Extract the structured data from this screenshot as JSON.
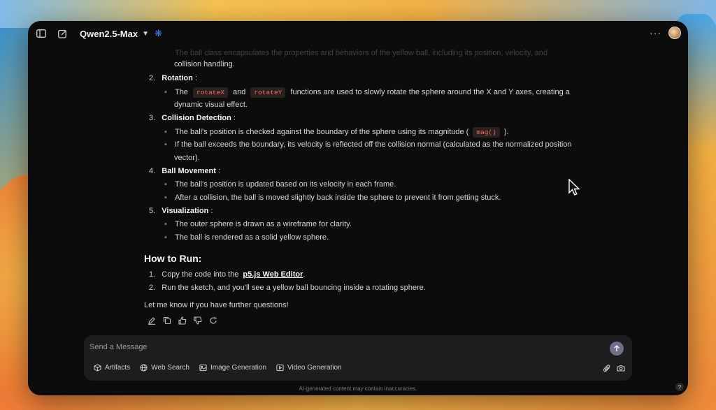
{
  "topbar": {
    "model_name": "Qwen2.5-Max",
    "sidebar_icon": "sidebar-toggle-icon",
    "new_chat_icon": "new-chat-icon"
  },
  "content": {
    "item1_tail_faded": "The  ball  class encapsulates the properties and behaviors of the yellow ball, including its position, velocity, and",
    "item1_tail": "collision handling.",
    "sections": [
      {
        "number": "2.",
        "title": "Rotation",
        "bullets": [
          {
            "pre": "The",
            "code1": "rotateX",
            "mid": "and",
            "code2": "rotateY",
            "post": "functions are used to slowly rotate the sphere around the X and Y axes, creating a"
          },
          {
            "text": "dynamic visual effect."
          }
        ]
      },
      {
        "number": "3.",
        "title": "Collision Detection",
        "bullets": [
          {
            "pre": "The ball's position is checked against the boundary of the sphere using its magnitude (",
            "code": "mag()",
            "post": ")."
          },
          {
            "text": "If the ball exceeds the boundary, its velocity is reflected off the collision normal (calculated as the normalized position"
          },
          {
            "text": "vector)."
          }
        ]
      },
      {
        "number": "4.",
        "title": "Ball Movement",
        "bullets": [
          {
            "text": "The ball's position is updated based on its velocity in each frame."
          },
          {
            "text": "After a collision, the ball is moved slightly back inside the sphere to prevent it from getting stuck."
          }
        ]
      },
      {
        "number": "5.",
        "title": "Visualization",
        "bullets": [
          {
            "text": "The outer sphere is drawn as a wireframe for clarity."
          },
          {
            "text": "The ball is rendered as a solid yellow sphere."
          }
        ]
      }
    ],
    "how_to_run_heading": "How to Run:",
    "steps": [
      {
        "number": "1.",
        "pre": "Copy the code into the",
        "link": "p5.js Web Editor",
        "post": "."
      },
      {
        "number": "2.",
        "text": "Run the sketch, and you'll see a yellow ball bouncing inside a rotating sphere."
      }
    ],
    "closing": "Let me know if you have further questions!"
  },
  "message_actions": [
    "edit-icon",
    "copy-icon",
    "thumbs-up-icon",
    "thumbs-down-icon",
    "regenerate-icon"
  ],
  "composer": {
    "placeholder": "Send a Message",
    "tools": [
      {
        "label": "Artifacts",
        "icon": "artifacts-icon"
      },
      {
        "label": "Web Search",
        "icon": "globe-icon"
      },
      {
        "label": "Image Generation",
        "icon": "image-icon"
      },
      {
        "label": "Video Generation",
        "icon": "video-icon"
      }
    ]
  },
  "disclaimer": "AI-generated content may contain inaccuracies.",
  "help_label": "?",
  "colors": {
    "code_text": "#f26b5b",
    "send_button": "#6d7086",
    "accent": "#3b7cf5"
  }
}
